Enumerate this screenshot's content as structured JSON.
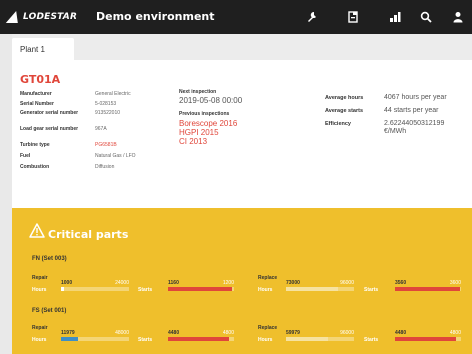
{
  "header": {
    "logo_text": "LODESTAR",
    "title": "Demo environment",
    "icons": [
      "wrench-icon",
      "document-icon",
      "bar-chart-icon",
      "search-icon",
      "user-icon"
    ]
  },
  "tabs": [
    {
      "label": "Plant 1"
    }
  ],
  "asset": {
    "id": "GT01A",
    "fields": [
      {
        "label": "Manufacturer",
        "value": "General Electric",
        "highlight": false
      },
      {
        "label": "Serial Number",
        "value": "5-028153",
        "highlight": false
      },
      {
        "label": "Generator serial number",
        "value": "913522010",
        "highlight": false
      },
      {
        "label": "Load gear serial number",
        "value": "967A",
        "highlight": false
      },
      {
        "label": "Turbine type",
        "value": "PG6581B",
        "highlight": true
      },
      {
        "label": "Fuel",
        "value": "Natural Gas / LFO",
        "highlight": false
      },
      {
        "label": "Combustion",
        "value": "Diffusion",
        "highlight": false
      }
    ],
    "next_inspection_label": "Next inspection",
    "next_inspection_value": "2019-05-08 00:00",
    "previous_inspections_label": "Previous inspections",
    "previous_inspections": [
      "Borescope 2016",
      "HGPI 2015",
      "CI 2013"
    ],
    "stats": [
      {
        "label": "Average hours",
        "value": "4067 hours per year"
      },
      {
        "label": "Average starts",
        "value": "44 starts per year"
      },
      {
        "label": "Efficiency",
        "value": "2.62244050312199 €/MWh"
      }
    ]
  },
  "critical": {
    "title": "Critical parts",
    "groups": [
      {
        "name": "FN (Set 003)",
        "repair": {
          "label": "Repair",
          "hours": {
            "label": "Hours",
            "current": "1000",
            "max": "24000",
            "fraction": 0.04,
            "color": "#ffffff"
          },
          "starts": {
            "label": "Starts",
            "current": "1160",
            "max": "1200",
            "fraction": 0.97,
            "color": "#e0463a"
          }
        },
        "replace": {
          "label": "Replace",
          "hours": {
            "label": "Hours",
            "current": "73000",
            "max": "96000",
            "fraction": 0.76,
            "color": "#f6e2a0"
          },
          "starts": {
            "label": "Starts",
            "current": "3560",
            "max": "3600",
            "fraction": 0.99,
            "color": "#e0463a"
          }
        }
      },
      {
        "name": "FS (Set 001)",
        "repair": {
          "label": "Repair",
          "hours": {
            "label": "Hours",
            "current": "11979",
            "max": "48000",
            "fraction": 0.25,
            "color": "#3f8fc5"
          },
          "starts": {
            "label": "Starts",
            "current": "4480",
            "max": "4800",
            "fraction": 0.93,
            "color": "#e0463a"
          }
        },
        "replace": {
          "label": "Replace",
          "hours": {
            "label": "Hours",
            "current": "59979",
            "max": "96000",
            "fraction": 0.62,
            "color": "#f6e2a0"
          },
          "starts": {
            "label": "Starts",
            "current": "4480",
            "max": "4800",
            "fraction": 0.93,
            "color": "#e0463a"
          }
        }
      }
    ]
  }
}
